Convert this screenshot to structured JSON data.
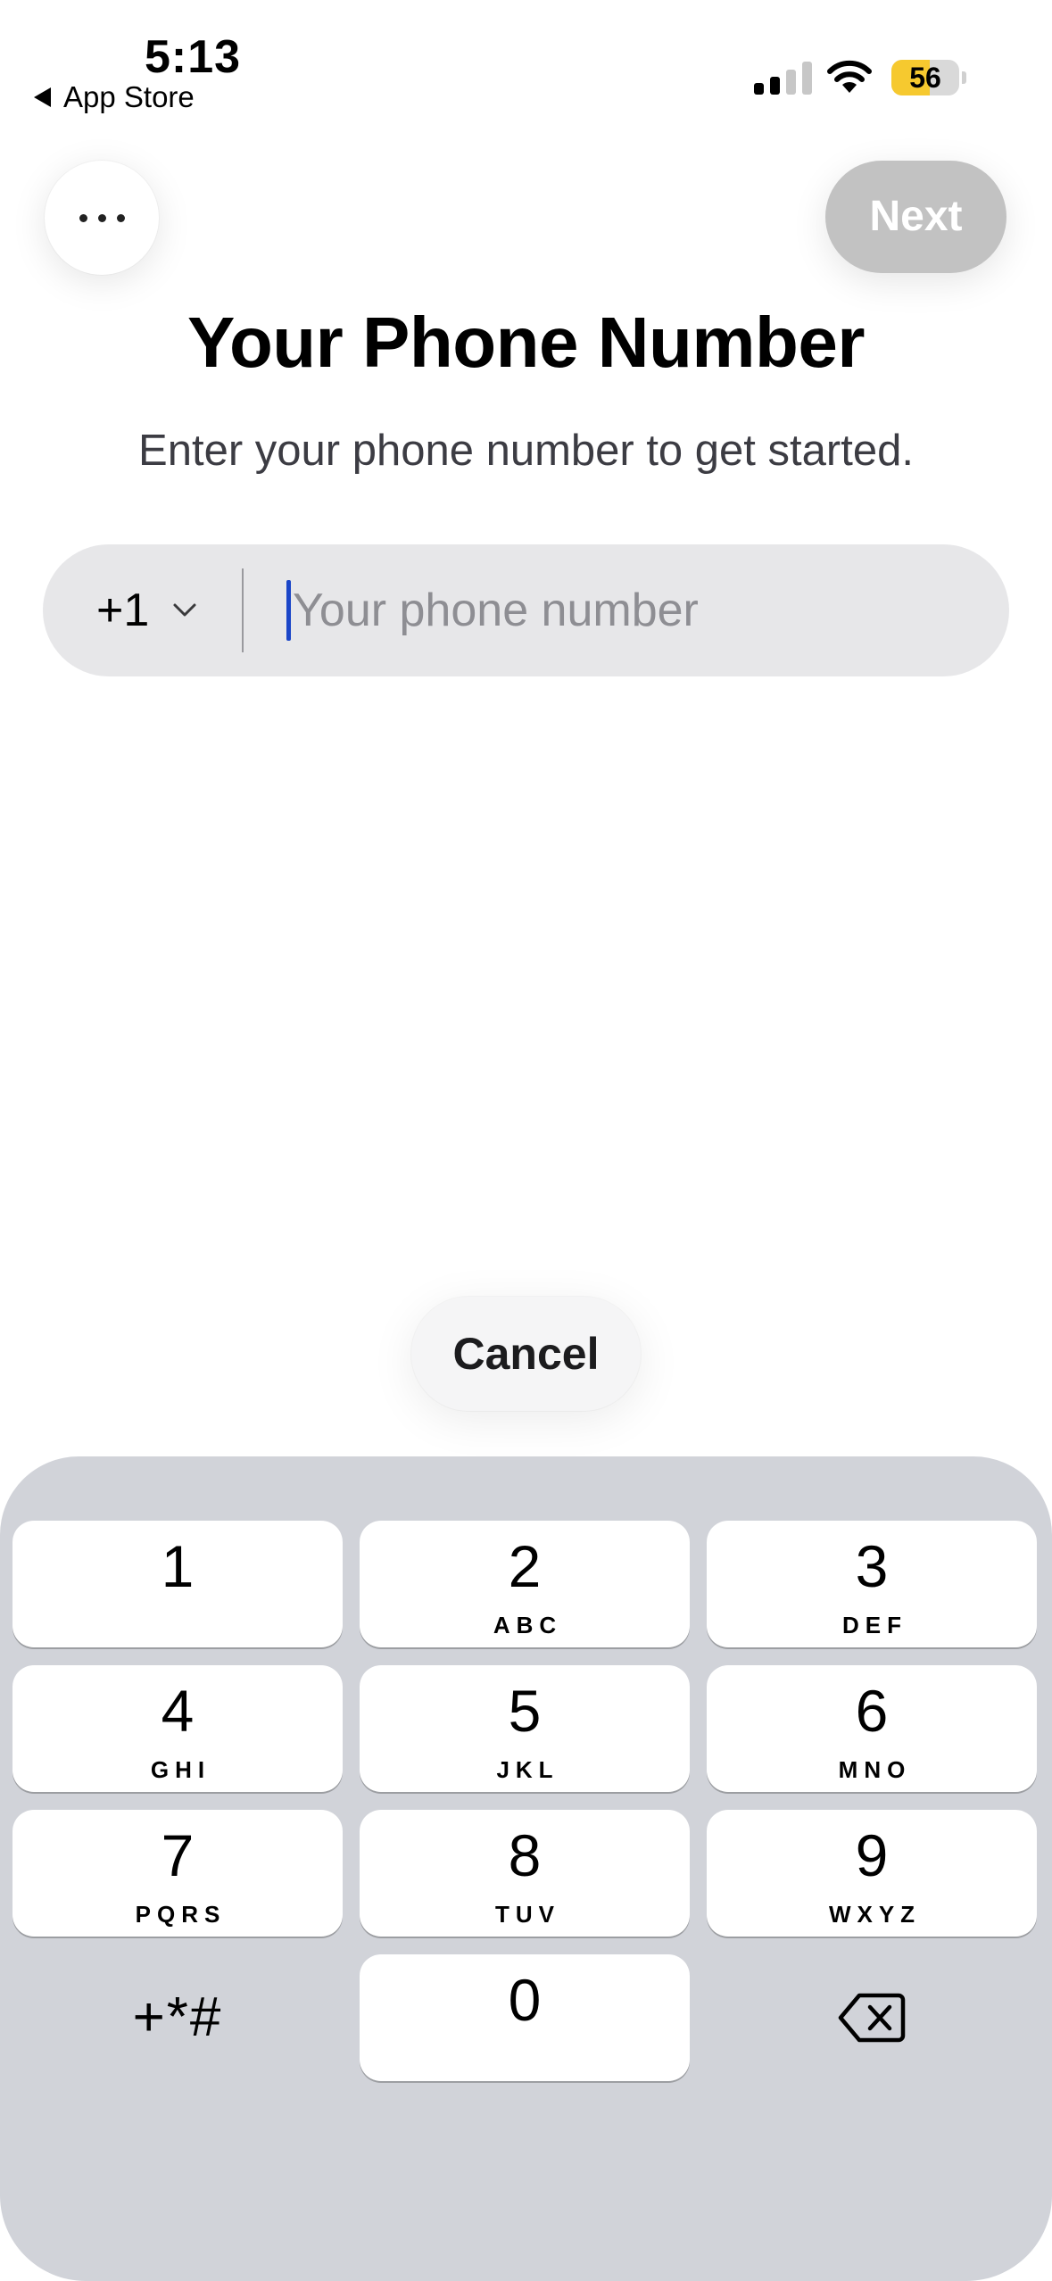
{
  "status_bar": {
    "time": "5:13",
    "back_label": "App Store",
    "battery_level": "56"
  },
  "header": {
    "more_icon": "ellipsis-icon",
    "next_label": "Next"
  },
  "main": {
    "title": "Your Phone Number",
    "subtitle": "Enter your phone number to get started.",
    "country_code": "+1",
    "phone_placeholder": "Your phone number",
    "phone_value": ""
  },
  "cancel_label": "Cancel",
  "keypad": {
    "keys": [
      {
        "digit": "1",
        "letters": ""
      },
      {
        "digit": "2",
        "letters": "ABC"
      },
      {
        "digit": "3",
        "letters": "DEF"
      },
      {
        "digit": "4",
        "letters": "GHI"
      },
      {
        "digit": "5",
        "letters": "JKL"
      },
      {
        "digit": "6",
        "letters": "MNO"
      },
      {
        "digit": "7",
        "letters": "PQRS"
      },
      {
        "digit": "8",
        "letters": "TUV"
      },
      {
        "digit": "9",
        "letters": "WXYZ"
      },
      {
        "digit": "0",
        "letters": ""
      }
    ],
    "symbols_label": "+*#",
    "backspace_icon": "backspace-icon"
  },
  "colors": {
    "caret": "#1b46c8",
    "keypad_background": "#d1d3d9",
    "next_disabled": "#c2c2c2",
    "battery_fill": "#f6c92f"
  }
}
